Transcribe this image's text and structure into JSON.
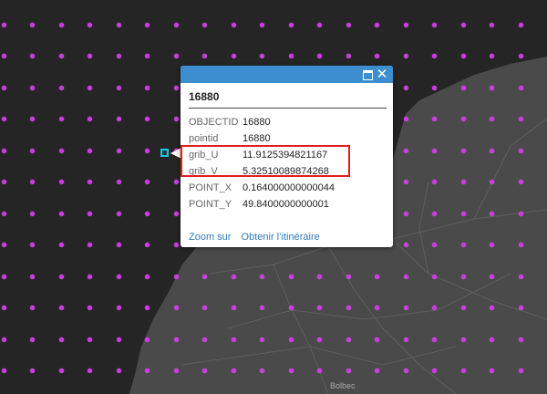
{
  "popup": {
    "title": "16880",
    "fields": [
      {
        "name": "OBJECTID",
        "value": "16880"
      },
      {
        "name": "pointid",
        "value": "16880"
      },
      {
        "name": "grib_U",
        "value": "11.9125394821167"
      },
      {
        "name": "grib_V",
        "value": "5.32510089874268"
      },
      {
        "name": "POINT_X",
        "value": "0.164000000000044"
      },
      {
        "name": "POINT_Y",
        "value": "49.8400000000001"
      }
    ],
    "actions": {
      "zoom": "Zoom sur",
      "directions": "Obtenir l’itinéraire"
    },
    "header_color": "#3d8ecf"
  },
  "map": {
    "place_label": "Bolbec",
    "water_color": "#252525",
    "land_color": "#4a4a4a",
    "point_color": "#d13ae8",
    "selection_color": "#22c4e6",
    "highlight_color": "#e01e1e"
  },
  "icons": {
    "maximize": "maximize-icon",
    "close": "close-icon"
  }
}
